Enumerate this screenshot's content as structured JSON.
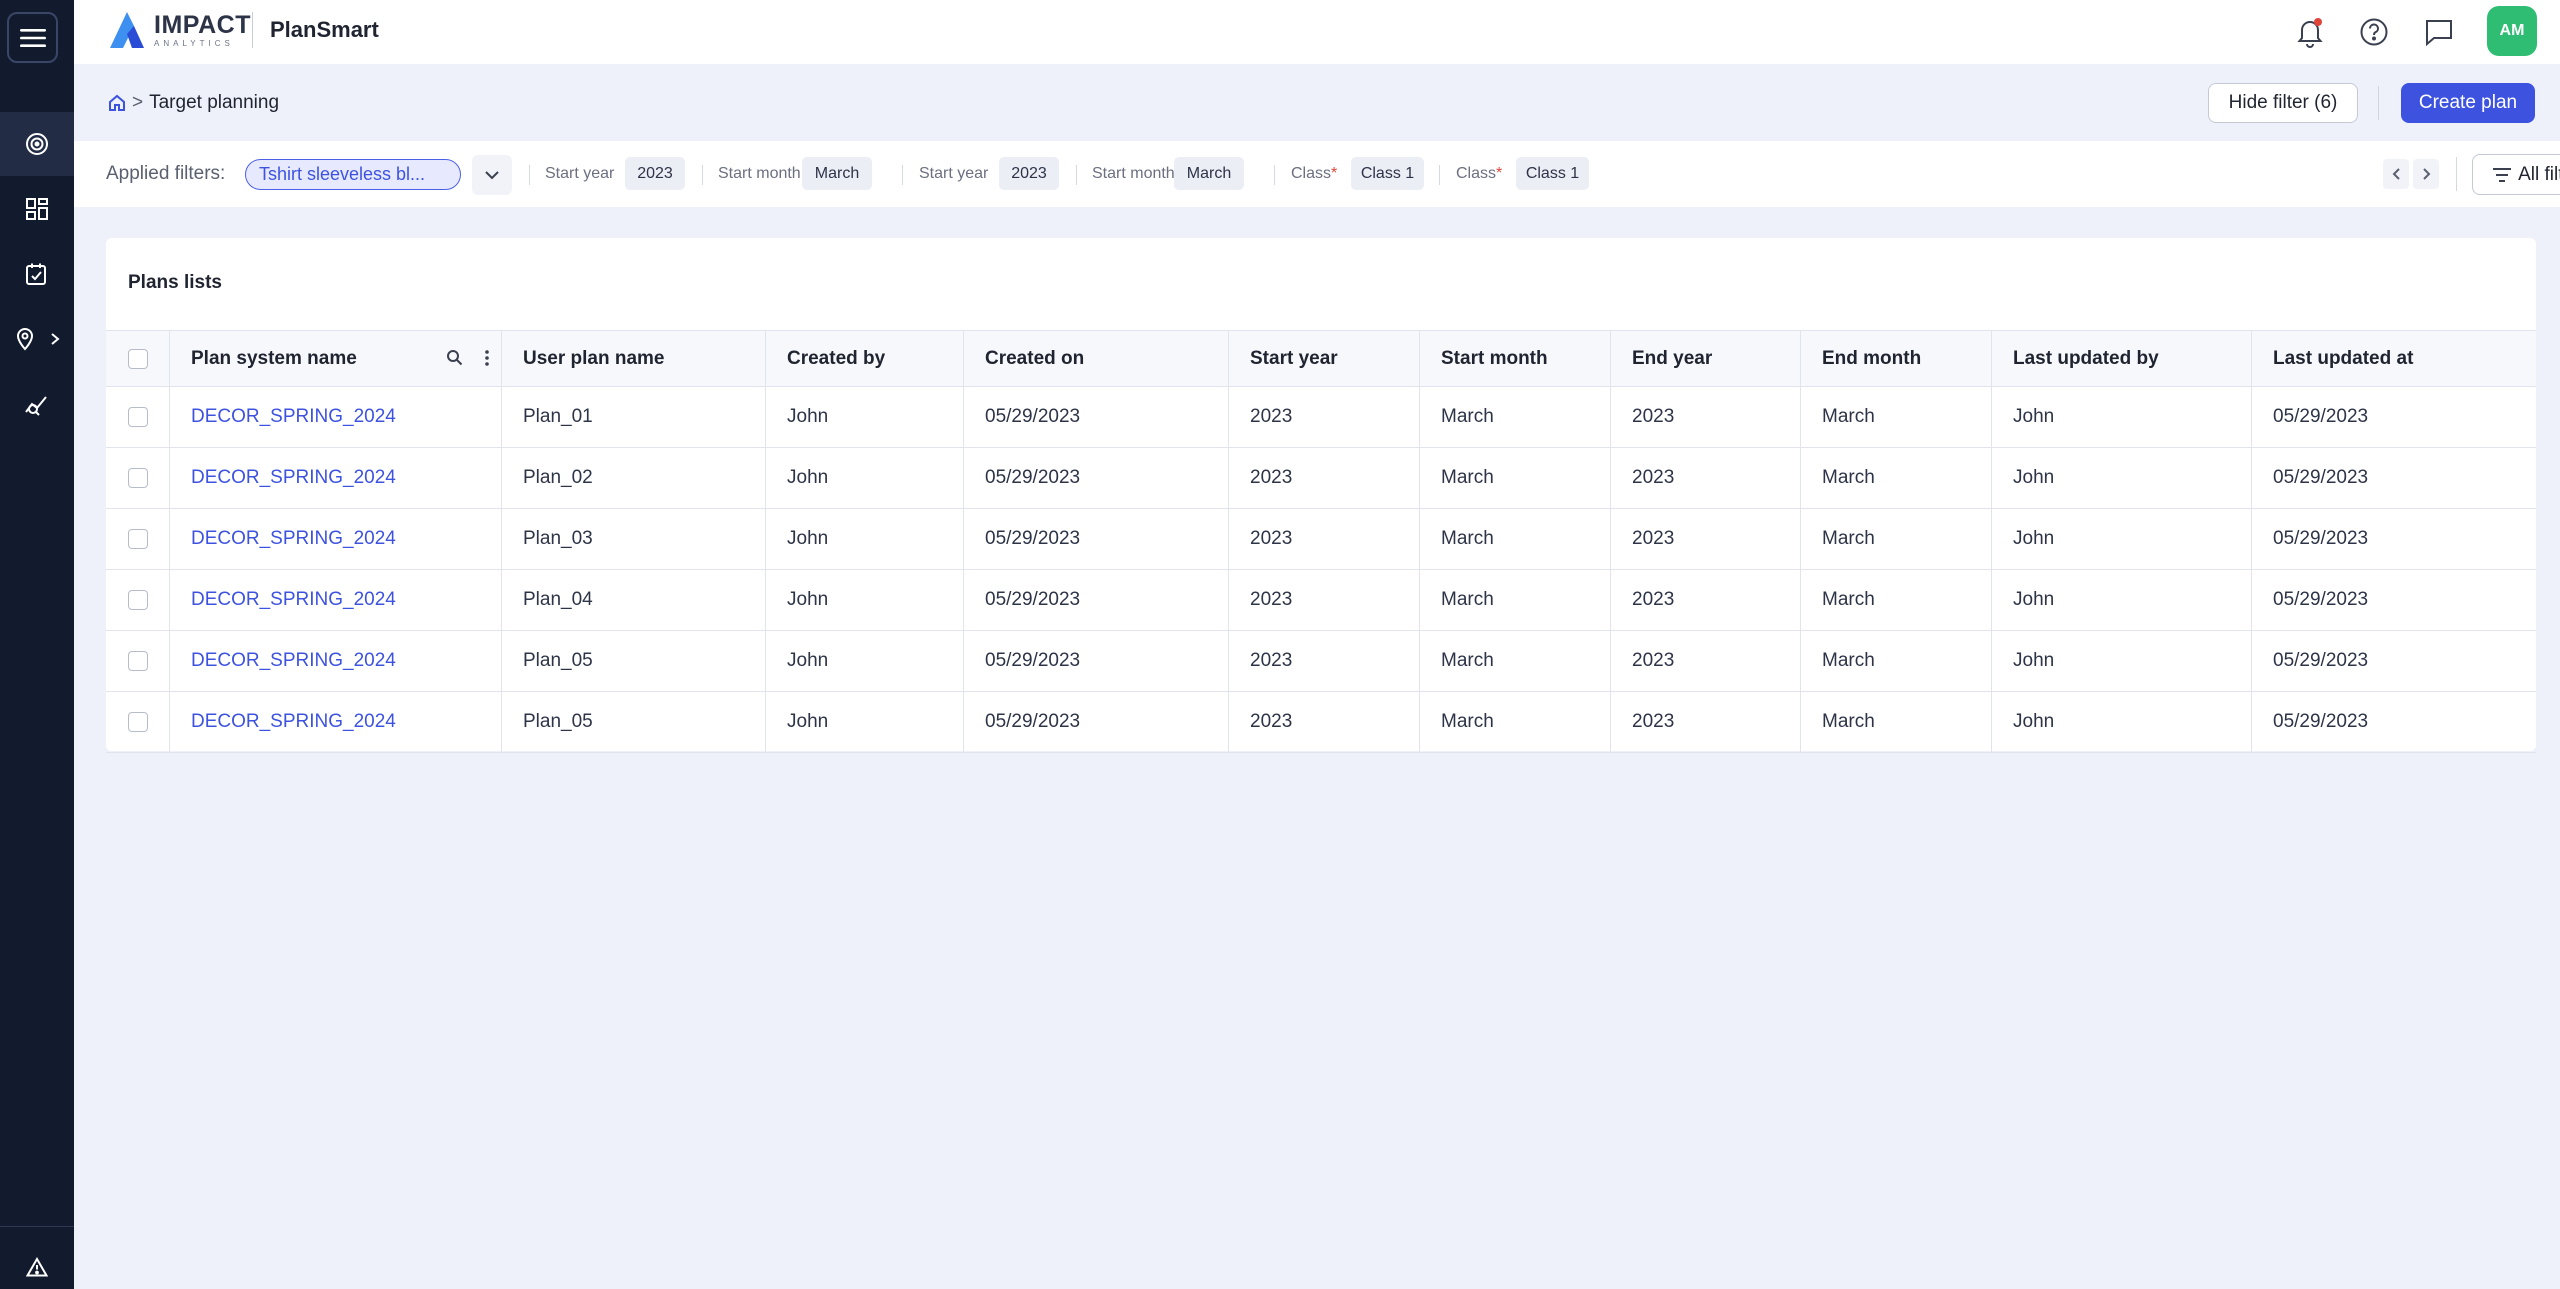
{
  "header": {
    "logo_main": "IMPACT",
    "logo_sub": "ANALYTICS",
    "app_title": "PlanSmart",
    "avatar_initials": "AM",
    "avatar_color": "#2ebd73"
  },
  "breadcrumb": {
    "separator": ">",
    "current": "Target planning"
  },
  "actions": {
    "hide_filter_label": "Hide filter (6)",
    "create_plan_label": "Create plan"
  },
  "filters": {
    "label": "Applied filters:",
    "main_chip": "Tshirt sleeveless bl...",
    "items": [
      {
        "name": "Start year",
        "value": "2023",
        "required": false
      },
      {
        "name": "Start month",
        "value": "March",
        "required": false
      },
      {
        "name": "Start year",
        "value": "2023",
        "required": false
      },
      {
        "name": "Start month",
        "value": "March",
        "required": false
      },
      {
        "name": "Class",
        "value": "Class 1",
        "required": true
      },
      {
        "name": "Class",
        "value": "Class 1",
        "required": true
      }
    ],
    "required_marker": "*",
    "all_filters_label": "All filters"
  },
  "plans": {
    "title": "Plans lists",
    "columns": [
      "Plan system name",
      "User plan name",
      "Created by",
      "Created on",
      "Start year",
      "Start month",
      "End year",
      "End month",
      "Last updated by",
      "Last updated at"
    ],
    "rows": [
      [
        "DECOR_SPRING_2024",
        "Plan_01",
        "John",
        "05/29/2023",
        "2023",
        "March",
        "2023",
        "March",
        "John",
        "05/29/2023"
      ],
      [
        "DECOR_SPRING_2024",
        "Plan_02",
        "John",
        "05/29/2023",
        "2023",
        "March",
        "2023",
        "March",
        "John",
        "05/29/2023"
      ],
      [
        "DECOR_SPRING_2024",
        "Plan_03",
        "John",
        "05/29/2023",
        "2023",
        "March",
        "2023",
        "March",
        "John",
        "05/29/2023"
      ],
      [
        "DECOR_SPRING_2024",
        "Plan_04",
        "John",
        "05/29/2023",
        "2023",
        "March",
        "2023",
        "March",
        "John",
        "05/29/2023"
      ],
      [
        "DECOR_SPRING_2024",
        "Plan_05",
        "John",
        "05/29/2023",
        "2023",
        "March",
        "2023",
        "March",
        "John",
        "05/29/2023"
      ],
      [
        "DECOR_SPRING_2024",
        "Plan_05",
        "John",
        "05/29/2023",
        "2023",
        "March",
        "2023",
        "March",
        "John",
        "05/29/2023"
      ]
    ]
  },
  "sidebar": {
    "icons": [
      "menu-icon",
      "target-icon",
      "dashboard-icon",
      "calendar-check-icon",
      "location-pin-icon",
      "analytics-icon",
      "warning-icon"
    ]
  },
  "colors": {
    "accent": "#3d53e0",
    "sidebar_bg": "#121a2e",
    "notification_dot": "#e0453a"
  }
}
